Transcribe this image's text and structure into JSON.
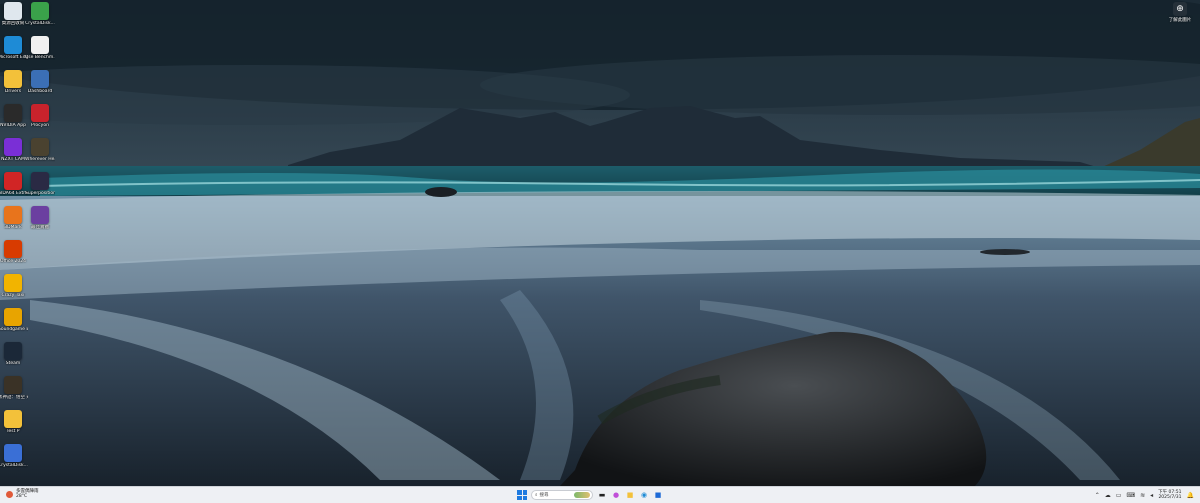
{
  "desktop": {
    "icons": [
      {
        "label": "資源回收筒",
        "icon": "recycle-bin-icon",
        "color": "#dfe7ee"
      },
      {
        "label": "CrystalDisk...",
        "icon": "crystaldisk-icon",
        "color": "#3aa14a"
      },
      {
        "label": "Microsoft Edge",
        "icon": "edge-icon",
        "color": "#1e8bd6"
      },
      {
        "label": "Use Benchm...",
        "icon": "userbenchmark-icon",
        "color": "#f0f0f0"
      },
      {
        "label": "Drivers",
        "icon": "folder-icon",
        "color": "#f3c13a"
      },
      {
        "label": "Dashboard",
        "icon": "dashboard-icon",
        "color": "#3b6fb6"
      },
      {
        "label": "NVIDIA App",
        "icon": "nvidia-icon",
        "color": "#2a2a2a"
      },
      {
        "label": "Procyon",
        "icon": "procyon-icon",
        "color": "#c8232c"
      },
      {
        "label": "NZXT CAM",
        "icon": "nzxt-icon",
        "color": "#7a2fd6"
      },
      {
        "label": "Wherever Heaven V5",
        "icon": "game-icon",
        "color": "#4a4230"
      },
      {
        "label": "AIDA64 Extreme",
        "icon": "aida64-icon",
        "color": "#d12525"
      },
      {
        "label": "Superposition Benchmark",
        "icon": "superposition-icon",
        "color": "#2a2a44"
      },
      {
        "label": "3DMark",
        "icon": "3dmark-icon",
        "color": "#e8741c"
      },
      {
        "label": "最佳實體",
        "icon": "app-icon",
        "color": "#6b3fa0"
      },
      {
        "label": "Office 2024",
        "icon": "office-icon",
        "color": "#d83b01"
      },
      {
        "label": "Crazy Taxi",
        "icon": "game-icon",
        "color": "#f2b400"
      },
      {
        "label": "Soundgame Empire",
        "icon": "game-icon",
        "color": "#e8a400"
      },
      {
        "label": "Steam",
        "icon": "steam-icon",
        "color": "#1b2838"
      },
      {
        "label": "黑神話：悟空 效能測試工具",
        "icon": "game-icon",
        "color": "#3a3226"
      },
      {
        "label": "Test P",
        "icon": "folder-icon",
        "color": "#f3c13a"
      },
      {
        "label": "CrystalDisk...",
        "icon": "crystaldisk-icon",
        "color": "#3a6fd6"
      }
    ],
    "corner_widget": {
      "label": "了解此圖片",
      "icon": "info-icon"
    }
  },
  "taskbar": {
    "weather": {
      "line1": "多雲偶陣雨",
      "line2": "28°C"
    },
    "search_placeholder": "搜尋",
    "pinned": [
      {
        "name": "file-explorer-icon",
        "glyph": "▬",
        "color": "#222"
      },
      {
        "name": "copilot-icon",
        "glyph": "●",
        "color": "#c04fd8"
      },
      {
        "name": "folder-icon",
        "glyph": "■",
        "color": "#f3c13a"
      },
      {
        "name": "edge-icon",
        "glyph": "◉",
        "color": "#1e8bd6"
      },
      {
        "name": "store-icon",
        "glyph": "■",
        "color": "#1e6ad6"
      }
    ],
    "tray": {
      "time": "下午 07:51",
      "date": "2025/7/31"
    }
  }
}
